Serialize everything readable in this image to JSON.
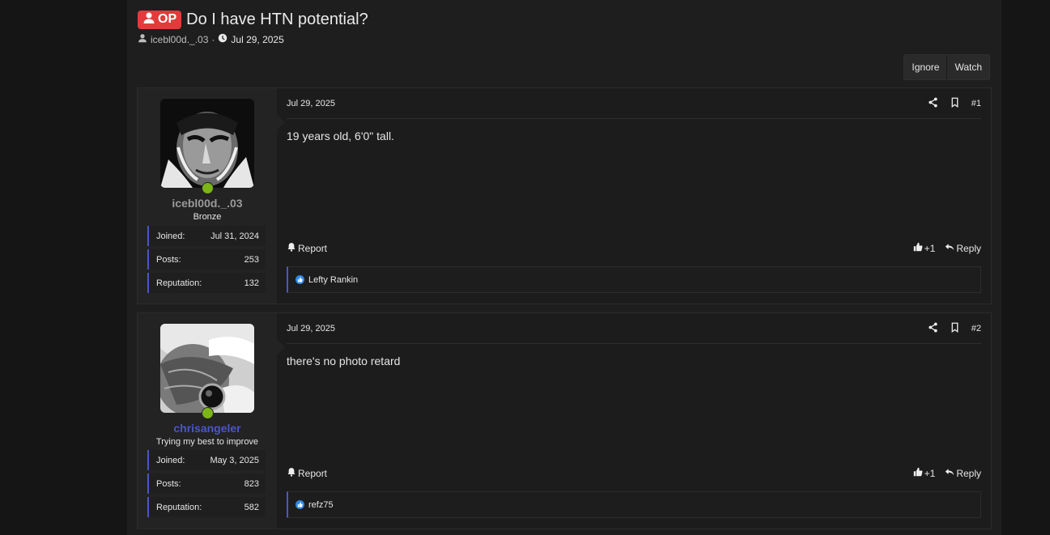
{
  "thread": {
    "op_badge": "OP",
    "title": "Do I have HTN potential?",
    "author": "icebl00d._.03",
    "separator": "·",
    "date": "Jul 29, 2025"
  },
  "buttons": {
    "ignore": "Ignore",
    "watch": "Watch"
  },
  "posts": [
    {
      "date": "Jul 29, 2025",
      "number": "#1",
      "username": "icebl00d._.03",
      "user_title": "Bronze",
      "username_color": "#9a9a9a",
      "stats": {
        "joined_label": "Joined:",
        "joined": "Jul 31, 2024",
        "posts_label": "Posts:",
        "posts": "253",
        "rep_label": "Reputation:",
        "reputation": "132"
      },
      "body": "19 years old, 6'0\" tall.",
      "report": "Report",
      "like_count": "+1",
      "reply": "Reply",
      "reacted_by": "Lefty Rankin"
    },
    {
      "date": "Jul 29, 2025",
      "number": "#2",
      "username": "chrisangeler",
      "user_title": "Trying my best to improve",
      "username_color": "#4a56c9",
      "stats": {
        "joined_label": "Joined:",
        "joined": "May 3, 2025",
        "posts_label": "Posts:",
        "posts": "823",
        "rep_label": "Reputation:",
        "reputation": "582"
      },
      "body": "there's no photo retard",
      "report": "Report",
      "like_count": "+1",
      "reply": "Reply",
      "reacted_by": "refz75"
    }
  ],
  "colors": {
    "accent": "#4a56c9",
    "op_red": "#e23b3b",
    "online": "#7cb518",
    "like_blue": "#2f89e6"
  },
  "icons": [
    "user-icon",
    "clock-icon",
    "share-icon",
    "bookmark-icon",
    "bell-icon",
    "thumbs-up-icon",
    "reply-icon"
  ]
}
